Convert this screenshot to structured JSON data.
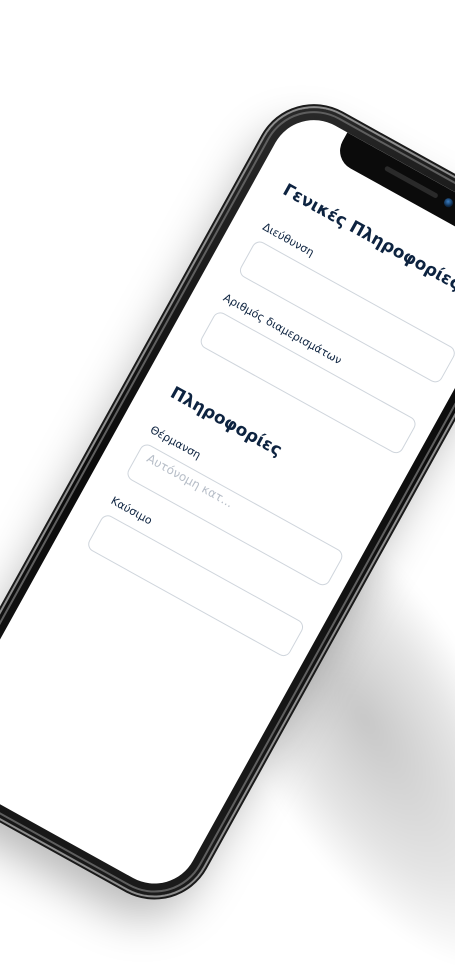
{
  "form": {
    "general": {
      "title": "Γενικές Πληροφορίες",
      "fields": [
        {
          "label": "Διεύθυνση",
          "value": ""
        },
        {
          "label": "Αριθμός διαμερισμάτων",
          "value": ""
        }
      ]
    },
    "info": {
      "title": "Πληροφορίες",
      "fields": [
        {
          "label": "Θέρμανση",
          "placeholder": "Αυτόνομη κατ..."
        },
        {
          "label": "Καύσιμο",
          "value": ""
        }
      ]
    }
  }
}
